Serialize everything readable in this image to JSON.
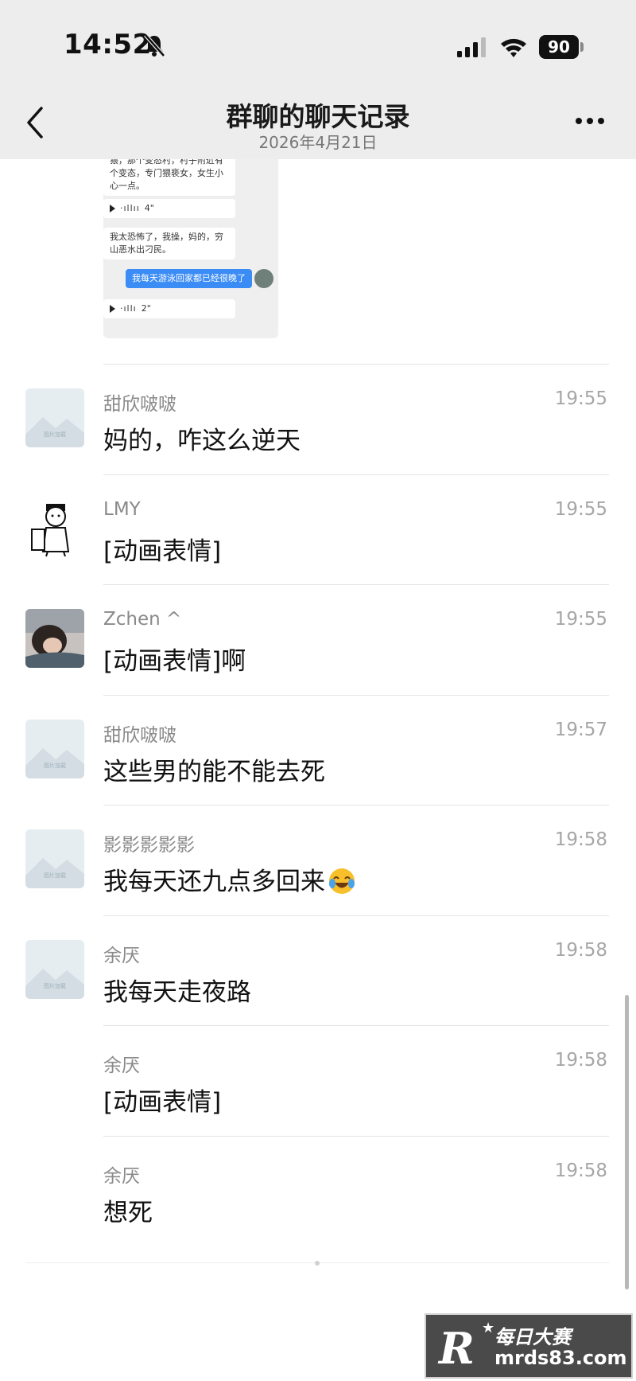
{
  "status_bar": {
    "time": "14:52",
    "battery": "90"
  },
  "header": {
    "title": "群聊的聊天记录",
    "date": "2026年4月21日"
  },
  "preview": {
    "msg1": "猥，那个变态村，村子附近有个变态，专门猥亵女，女生小心一点。",
    "voice1": "4\"",
    "msg2": "我太恐怖了，我操，妈的，穷山恶水出刁民。",
    "blue_msg": "我每天游泳回家都已经很晚了",
    "voice2": "2\""
  },
  "messages": [
    {
      "sender": "甜欣啵啵",
      "time": "19:55",
      "text": "妈的，咋这么逆天",
      "avatar": "placeholder"
    },
    {
      "sender": "LMY",
      "time": "19:55",
      "text": "[动画表情]",
      "avatar": "cartoon"
    },
    {
      "sender": "Zchen ^",
      "time": "19:55",
      "text": "[动画表情]啊",
      "avatar": "photo"
    },
    {
      "sender": "甜欣啵啵",
      "time": "19:57",
      "text": "这些男的能不能去死",
      "avatar": "placeholder"
    },
    {
      "sender": "影影影影影",
      "time": "19:58",
      "text": "我每天还九点多回来",
      "avatar": "placeholder",
      "emoji": "crying-laughing-emoji"
    },
    {
      "sender": "余厌",
      "time": "19:58",
      "text": "我每天走夜路",
      "avatar": "placeholder"
    },
    {
      "sender": "余厌",
      "time": "19:58",
      "text": "[动画表情]",
      "avatar": "none"
    },
    {
      "sender": "余厌",
      "time": "19:58",
      "text": "想死",
      "avatar": "none"
    }
  ],
  "watermark": {
    "letter": "R",
    "cn": "每日大赛",
    "url": "mrds83.com"
  },
  "colors": {
    "topbar": "#ededed",
    "accent_blue": "#3b8cf5"
  }
}
